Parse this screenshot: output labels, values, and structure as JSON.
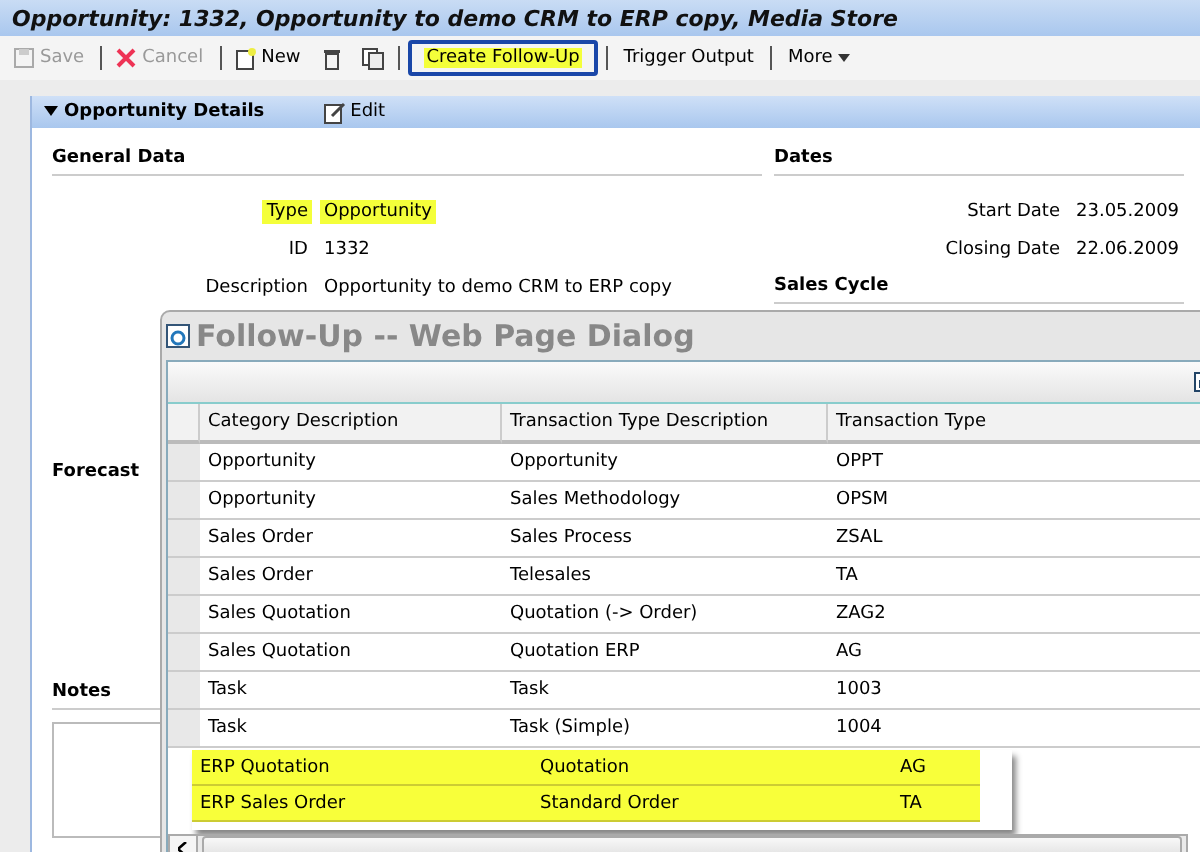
{
  "window": {
    "title": "Opportunity: 1332, Opportunity to demo CRM to ERP copy, Media Store"
  },
  "toolbar": [
    {
      "label": "Save",
      "kind": "save",
      "disabled": true,
      "highlighted": false
    },
    {
      "label": "Cancel",
      "kind": "cancel",
      "disabled": true,
      "highlighted": false
    },
    {
      "label": "New",
      "kind": "new",
      "disabled": false,
      "highlighted": false
    },
    {
      "kind": "delete",
      "disabled": false,
      "highlighted": false
    },
    {
      "kind": "copy",
      "disabled": false,
      "highlighted": false
    },
    {
      "label": "Create Follow-Up",
      "kind": "text",
      "disabled": false,
      "highlighted": true
    },
    {
      "label": "Trigger Output",
      "kind": "text",
      "disabled": false,
      "highlighted": false
    },
    {
      "label": "More",
      "kind": "menu",
      "disabled": false,
      "highlighted": false
    }
  ],
  "panel": {
    "title": "Opportunity Details",
    "edit": "Edit",
    "general": {
      "title": "General Data",
      "fields": [
        {
          "label": "Type",
          "value": "Opportunity",
          "highlighted": true
        },
        {
          "label": "ID",
          "value": "1332",
          "highlighted": false
        },
        {
          "label": "Description",
          "value": "Opportunity to demo CRM to ERP copy",
          "highlighted": false
        }
      ]
    },
    "dates": {
      "title": "Dates",
      "fields": [
        {
          "label": "Start Date",
          "value": "23.05.2009"
        },
        {
          "label": "Closing Date",
          "value": "22.06.2009"
        }
      ]
    },
    "sales_cycle": "Sales Cycle",
    "forecast": "Forecast",
    "notes": "Notes"
  },
  "dialog": {
    "title": "Follow-Up -- Web Page Dialog",
    "columns": [
      "Category Description",
      "Transaction Type Description",
      "Transaction Type"
    ],
    "rows": [
      [
        "Opportunity",
        "Opportunity",
        "OPPT"
      ],
      [
        "Opportunity",
        "Sales Methodology",
        "OPSM"
      ],
      [
        "Sales Order",
        "Sales Process",
        "ZSAL"
      ],
      [
        "Sales Order",
        "Telesales",
        "TA"
      ],
      [
        "Sales Quotation",
        "Quotation (-> Order)",
        "ZAG2"
      ],
      [
        "Sales Quotation",
        "Quotation ERP",
        "AG"
      ],
      [
        "Task",
        "Task",
        "1003"
      ],
      [
        "Task",
        "Task (Simple)",
        "1004"
      ]
    ],
    "highlight_rows": [
      [
        "ERP Quotation",
        "Quotation",
        "AG"
      ],
      [
        "ERP Sales Order",
        "Standard Order",
        "TA"
      ]
    ]
  }
}
